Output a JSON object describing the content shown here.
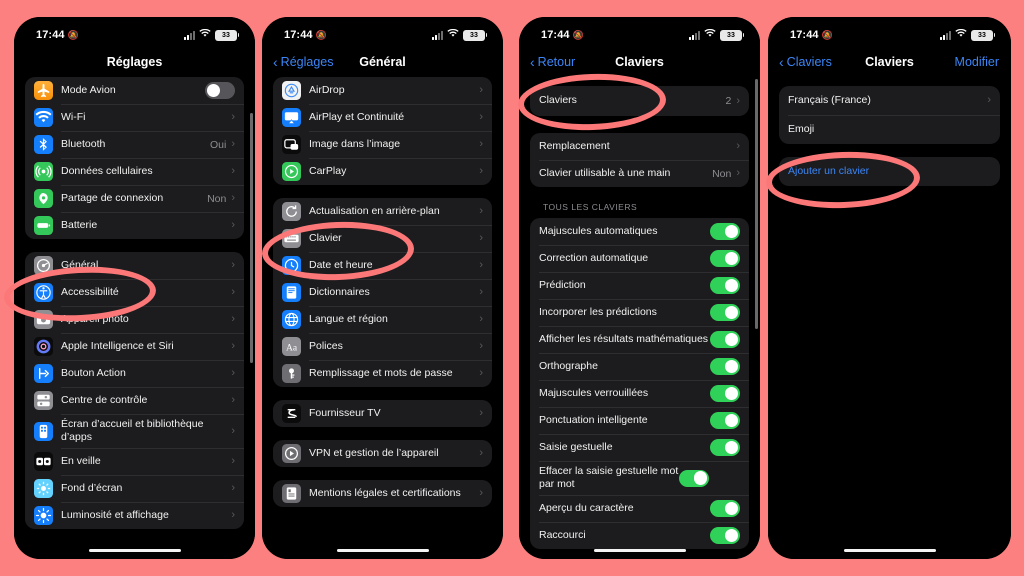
{
  "theme": {
    "accent_red": "#fc7878",
    "background_pink": "#fc8080",
    "link_blue": "#3b86f7",
    "toggle_green": "#30d158",
    "row_bg": "#1c1c1e"
  },
  "status_bar": {
    "time": "17:44",
    "silent_icon": "bell-slash-icon",
    "signal_icon": "cellular-signal-icon",
    "wifi_icon": "wifi-icon",
    "battery_level": "33"
  },
  "screens": [
    {
      "id": "settings-root",
      "nav": {
        "title": "Réglages",
        "back": null,
        "right": null
      },
      "groups": [
        {
          "rows": [
            {
              "label": "Mode Avion",
              "icon": "airplane-icon",
              "icon_style": "grad-orange",
              "control": "toggle",
              "toggle_on": false
            },
            {
              "label": "Wi-Fi",
              "icon": "wifi-icon",
              "icon_style": "blue",
              "control": "chevron"
            },
            {
              "label": "Bluetooth",
              "icon": "bluetooth-icon",
              "icon_style": "blue",
              "value": "Oui",
              "control": "chevron"
            },
            {
              "label": "Données cellulaires",
              "icon": "cellular-icon",
              "icon_style": "green",
              "control": "chevron"
            },
            {
              "label": "Partage de connexion",
              "icon": "hotspot-icon",
              "icon_style": "green",
              "value": "Non",
              "control": "chevron"
            },
            {
              "label": "Batterie",
              "icon": "battery-icon",
              "icon_style": "green",
              "control": "chevron"
            }
          ]
        },
        {
          "rows": [
            {
              "label": "Général",
              "icon": "gear-icon",
              "icon_style": "gray",
              "control": "chevron",
              "highlighted": true
            },
            {
              "label": "Accessibilité",
              "icon": "accessibility-icon",
              "icon_style": "blue",
              "control": "chevron",
              "obscured": true
            },
            {
              "label": "Appareil photo",
              "icon": "camera-icon",
              "icon_style": "gray",
              "control": "chevron"
            },
            {
              "label": "Apple Intelligence et Siri",
              "icon": "siri-icon",
              "icon_style": "black",
              "control": "chevron"
            },
            {
              "label": "Bouton Action",
              "icon": "action-button-icon",
              "icon_style": "blue",
              "control": "chevron"
            },
            {
              "label": "Centre de contrôle",
              "icon": "control-center-icon",
              "icon_style": "gray",
              "control": "chevron"
            },
            {
              "label": "Écran d’accueil et bibliothèque d’apps",
              "icon": "home-screen-icon",
              "icon_style": "blue",
              "control": "chevron"
            },
            {
              "label": "En veille",
              "icon": "standby-icon",
              "icon_style": "black",
              "control": "chevron"
            },
            {
              "label": "Fond d’écran",
              "icon": "wallpaper-icon",
              "icon_style": "cyan",
              "control": "chevron"
            },
            {
              "label": "Luminosité et affichage",
              "icon": "brightness-icon",
              "icon_style": "blue",
              "control": "chevron"
            }
          ]
        }
      ]
    },
    {
      "id": "general",
      "nav": {
        "title": "Général",
        "back": "Réglages",
        "right": null
      },
      "groups": [
        {
          "rows": [
            {
              "label": "AirDrop",
              "icon": "airdrop-icon",
              "icon_style": "white",
              "control": "chevron"
            },
            {
              "label": "AirPlay et Continuité",
              "icon": "airplay-icon",
              "icon_style": "blue",
              "control": "chevron"
            },
            {
              "label": "Image dans l’image",
              "icon": "pip-icon",
              "icon_style": "black",
              "control": "chevron"
            },
            {
              "label": "CarPlay",
              "icon": "carplay-icon",
              "icon_style": "green",
              "control": "chevron"
            }
          ]
        },
        {
          "rows": [
            {
              "label": "Actualisation en arrière-plan",
              "label_visible": "arrière-plan",
              "icon": "refresh-icon",
              "icon_style": "gray",
              "control": "chevron",
              "obscured": true
            },
            {
              "label": "Clavier",
              "icon": "keyboard-icon",
              "icon_style": "gray",
              "control": "chevron",
              "highlighted": true
            },
            {
              "label": "Date et heure",
              "label_visible": "Date et h",
              "icon": "clock-icon",
              "icon_style": "blue",
              "control": "chevron",
              "obscured": true
            },
            {
              "label": "Dictionnaires",
              "icon": "dictionary-icon",
              "icon_style": "blue",
              "control": "chevron"
            },
            {
              "label": "Langue et région",
              "icon": "globe-icon",
              "icon_style": "blue",
              "control": "chevron"
            },
            {
              "label": "Polices",
              "icon": "fonts-icon",
              "icon_style": "gray",
              "control": "chevron"
            },
            {
              "label": "Remplissage et mots de passe",
              "icon": "passwords-icon",
              "icon_style": "grayd",
              "control": "chevron"
            }
          ]
        },
        {
          "rows": [
            {
              "label": "Fournisseur TV",
              "icon": "tv-provider-icon",
              "icon_style": "black",
              "control": "chevron"
            }
          ]
        },
        {
          "rows": [
            {
              "label": "VPN et gestion de l’appareil",
              "icon": "vpn-icon",
              "icon_style": "grayd",
              "control": "chevron"
            }
          ]
        },
        {
          "rows": [
            {
              "label": "Mentions légales et certifications",
              "icon": "legal-icon",
              "icon_style": "grayd",
              "control": "chevron"
            }
          ]
        }
      ]
    },
    {
      "id": "keyboards-settings",
      "nav": {
        "title": "Claviers",
        "back": "Retour",
        "right": null
      },
      "groups": [
        {
          "rows": [
            {
              "label": "Claviers",
              "value": "2",
              "control": "chevron",
              "highlighted": true
            }
          ]
        },
        {
          "rows": [
            {
              "label": "Remplacement",
              "control": "chevron"
            },
            {
              "label": "Clavier utilisable à une main",
              "value": "Non",
              "control": "chevron"
            }
          ]
        }
      ],
      "section_header": "TOUS LES CLAVIERS",
      "toggle_group": {
        "rows": [
          {
            "label": "Majuscules automatiques",
            "toggle_on": true
          },
          {
            "label": "Correction automatique",
            "toggle_on": true
          },
          {
            "label": "Prédiction",
            "toggle_on": true
          },
          {
            "label": "Incorporer les prédictions",
            "toggle_on": true
          },
          {
            "label": "Afficher les résultats mathématiques",
            "toggle_on": true
          },
          {
            "label": "Orthographe",
            "toggle_on": true
          },
          {
            "label": "Majuscules verrouillées",
            "toggle_on": true
          },
          {
            "label": "Ponctuation intelligente",
            "toggle_on": true
          },
          {
            "label": "Saisie gestuelle",
            "toggle_on": true
          },
          {
            "label": "Effacer la saisie gestuelle mot par mot",
            "toggle_on": true
          },
          {
            "label": "Aperçu du caractère",
            "toggle_on": true
          },
          {
            "label": "Raccourci",
            "toggle_on": true,
            "clipped": true
          }
        ]
      }
    },
    {
      "id": "keyboards-list",
      "nav": {
        "title": "Claviers",
        "back": "Claviers",
        "right": "Modifier"
      },
      "groups": [
        {
          "rows": [
            {
              "label": "Français (France)",
              "control": "chevron"
            },
            {
              "label": "Emoji",
              "control": "none"
            }
          ]
        },
        {
          "rows": [
            {
              "label": "Ajouter un clavier",
              "control": "none",
              "link": true,
              "highlighted": true
            }
          ]
        }
      ]
    }
  ],
  "annotations": [
    {
      "name": "highlight-general",
      "screen": 1
    },
    {
      "name": "highlight-clavier",
      "screen": 2
    },
    {
      "name": "highlight-claviers-row",
      "screen": 3
    },
    {
      "name": "highlight-ajouter-un-clavier",
      "screen": 4
    }
  ]
}
